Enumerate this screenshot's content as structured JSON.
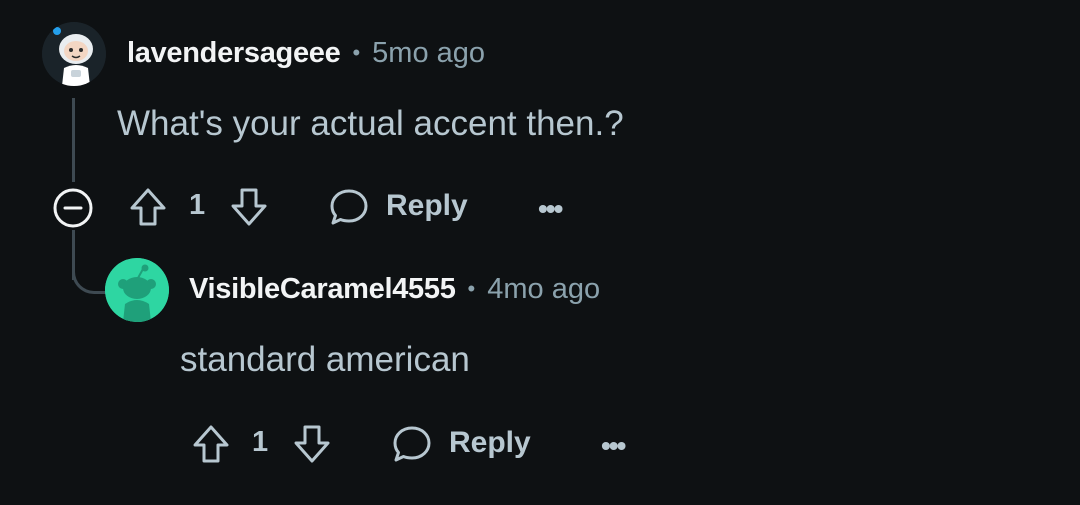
{
  "comments": [
    {
      "username": "lavendersageee",
      "separator": "•",
      "time": "5mo ago",
      "text": "What's your actual accent then.?",
      "votes": "1",
      "reply_label": "Reply",
      "more": "•••",
      "avatar_color": "#1a2329"
    },
    {
      "username": "VisibleCaramel4555",
      "separator": "•",
      "time": "4mo ago",
      "text": "standard american",
      "votes": "1",
      "reply_label": "Reply",
      "more": "•••",
      "avatar_color": "#2ed6a2"
    }
  ],
  "colors": {
    "background": "#0e1113",
    "text": "#b7c7d0",
    "username": "#f2f4f5",
    "muted": "#8ba2ad",
    "thread_line": "#3e4a52"
  },
  "icons": {
    "collapse": "minus-circle-icon",
    "upvote": "arrow-up-icon",
    "downvote": "arrow-down-icon",
    "reply": "speech-bubble-icon",
    "more": "ellipsis-icon"
  }
}
